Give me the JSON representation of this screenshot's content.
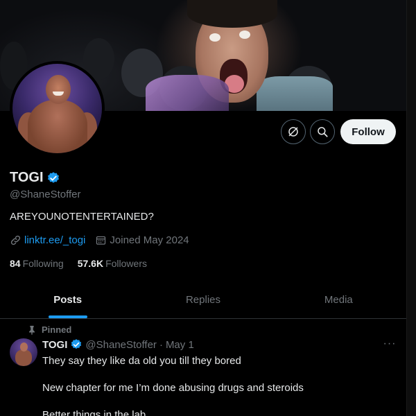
{
  "profile": {
    "display_name": "TOGI",
    "handle": "@ShaneStoffer",
    "bio": "AREYOUNOTENTERTAINED?",
    "link": "linktr.ee/_togi",
    "joined": "Joined May 2024",
    "following_count": "84",
    "following_label": "Following",
    "followers_count": "57.6K",
    "followers_label": "Followers"
  },
  "actions": {
    "follow_label": "Follow",
    "grok_icon": "grok-icon",
    "search_icon": "search-icon"
  },
  "tabs": [
    {
      "label": "Posts",
      "active": true
    },
    {
      "label": "Replies",
      "active": false
    },
    {
      "label": "Media",
      "active": false
    }
  ],
  "post": {
    "pinned_label": "Pinned",
    "author_name": "TOGI",
    "author_handle": "@ShaneStoffer",
    "dot": "·",
    "date": "May 1",
    "more": "···",
    "lines": [
      "They say they like da old you till they bored",
      "New chapter for me I’m done abusing drugs and steroids",
      "Better things in the lab"
    ]
  },
  "colors": {
    "accent": "#1d9bf0",
    "text_primary": "#e7e9ea",
    "text_secondary": "#71767b",
    "background": "#000000",
    "follow_button_bg": "#eff3f4"
  }
}
